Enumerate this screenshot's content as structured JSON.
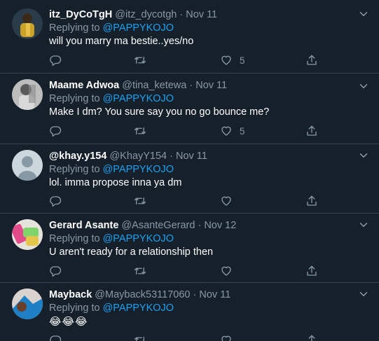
{
  "replies": [
    {
      "display_name": "itz_DyCoTgH",
      "handle": "@itz_dycotgh",
      "date": "Nov 11",
      "replying_prefix": "Replying to",
      "replying_to": "@PAPPYKOJO",
      "text": "will you marry ma bestie..yes/no",
      "reply_count": "",
      "retweet_count": "",
      "like_count": "5",
      "avatar_colors": [
        "#c9a227",
        "#3b2a1a"
      ]
    },
    {
      "display_name": "Maame Adwoa",
      "handle": "@tina_ketewa",
      "date": "Nov 11",
      "replying_prefix": "Replying to",
      "replying_to": "@PAPPYKOJO",
      "text": "Make I dm? You sure say you no go bounce me?",
      "reply_count": "",
      "retweet_count": "",
      "like_count": "5",
      "avatar_colors": [
        "#cfcfcf",
        "#6e6e6e"
      ]
    },
    {
      "display_name": "@khay.y154",
      "handle": "@KhayY154",
      "date": "Nov 11",
      "replying_prefix": "Replying to",
      "replying_to": "@PAPPYKOJO",
      "text": "lol. imma propose inna ya dm",
      "reply_count": "",
      "retweet_count": "",
      "like_count": "",
      "avatar_colors": [
        "#ccd6dd",
        "#8899a6"
      ]
    },
    {
      "display_name": "Gerard Asante",
      "handle": "@AsanteGerard",
      "date": "Nov 12",
      "replying_prefix": "Replying to",
      "replying_to": "@PAPPYKOJO",
      "text": "U aren't ready for a relationship then",
      "reply_count": "",
      "retweet_count": "",
      "like_count": "",
      "avatar_colors": [
        "#e14b8a",
        "#7fd36b"
      ]
    },
    {
      "display_name": "Mayback",
      "handle": "@Mayback53117060",
      "date": "Nov 11",
      "replying_prefix": "Replying to",
      "replying_to": "@PAPPYKOJO",
      "text": "😂😂😂",
      "reply_count": "",
      "retweet_count": "",
      "like_count": "",
      "avatar_colors": [
        "#1e7fc4",
        "#d9d2cf"
      ]
    }
  ],
  "separator": "·",
  "colors": {
    "background": "#15202b",
    "muted": "#8899a6",
    "link": "#1da1f2",
    "border": "#38444d"
  }
}
